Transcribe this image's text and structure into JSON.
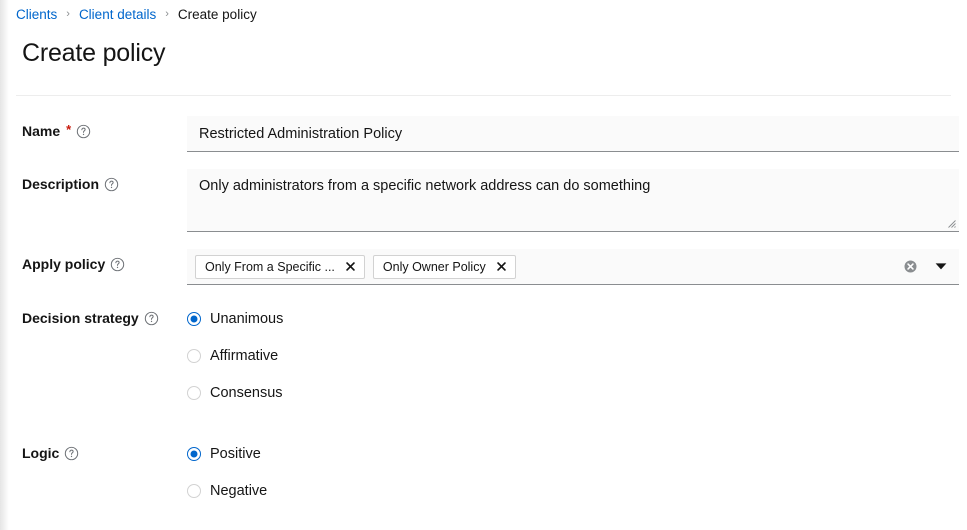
{
  "breadcrumb": {
    "items": [
      {
        "label": "Clients",
        "link": true
      },
      {
        "label": "Client details",
        "link": true
      },
      {
        "label": "Create policy",
        "link": false
      }
    ],
    "separator": "›"
  },
  "page": {
    "title": "Create policy"
  },
  "colors": {
    "link": "#0066cc",
    "accent": "#0066cc",
    "required": "#c9190b",
    "text": "#151515",
    "border": "#8a8d90"
  },
  "form": {
    "name": {
      "label": "Name",
      "required": true,
      "required_marker": "*",
      "help_icon": "help-circle-icon",
      "value": "Restricted Administration Policy",
      "placeholder": ""
    },
    "description": {
      "label": "Description",
      "help_icon": "help-circle-icon",
      "value": "Only administrators from a specific network address can do something",
      "placeholder": ""
    },
    "apply_policy": {
      "label": "Apply policy",
      "help_icon": "help-circle-icon",
      "chips": [
        {
          "label": "Only From a Specific ...",
          "remove_icon": "close-icon"
        },
        {
          "label": "Only Owner Policy",
          "remove_icon": "close-icon"
        }
      ],
      "clear_icon": "clear-all-icon",
      "toggle_icon": "chevron-down-icon"
    },
    "decision_strategy": {
      "label": "Decision strategy",
      "help_icon": "help-circle-icon",
      "selected": "Unanimous",
      "options": [
        {
          "label": "Unanimous",
          "checked": true
        },
        {
          "label": "Affirmative",
          "checked": false
        },
        {
          "label": "Consensus",
          "checked": false
        }
      ]
    },
    "logic": {
      "label": "Logic",
      "help_icon": "help-circle-icon",
      "selected": "Positive",
      "options": [
        {
          "label": "Positive",
          "checked": true
        },
        {
          "label": "Negative",
          "checked": false
        }
      ]
    }
  }
}
